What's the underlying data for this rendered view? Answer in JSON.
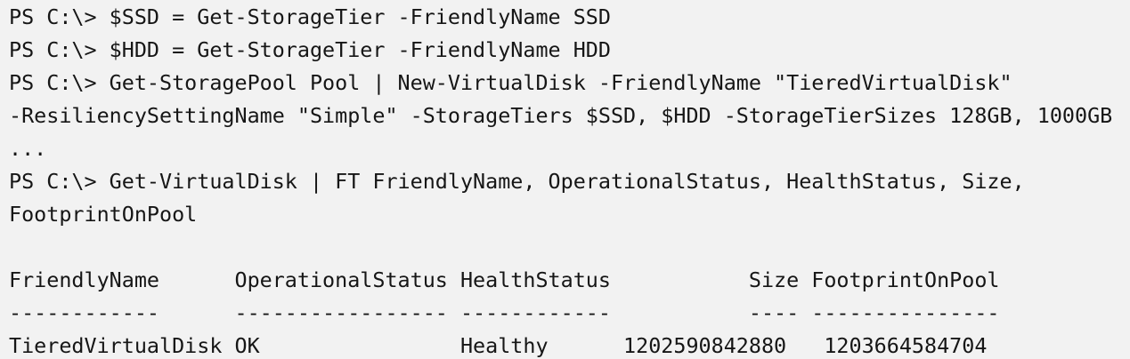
{
  "console": {
    "lines": [
      "PS C:\\> $SSD = Get-StorageTier -FriendlyName SSD",
      "PS C:\\> $HDD = Get-StorageTier -FriendlyName HDD",
      "PS C:\\> Get-StoragePool Pool | New-VirtualDisk -FriendlyName \"TieredVirtualDisk\"",
      "-ResiliencySettingName \"Simple\" -StorageTiers $SSD, $HDD -StorageTierSizes 128GB, 1000GB",
      "...",
      "PS C:\\> Get-VirtualDisk | FT FriendlyName, OperationalStatus, HealthStatus, Size,",
      "FootprintOnPool",
      "",
      "FriendlyName      OperationalStatus HealthStatus           Size FootprintOnPool",
      "------------      ----------------- ------------           ---- ---------------",
      "TieredVirtualDisk OK                Healthy      1202590842880   1203664584704"
    ]
  }
}
